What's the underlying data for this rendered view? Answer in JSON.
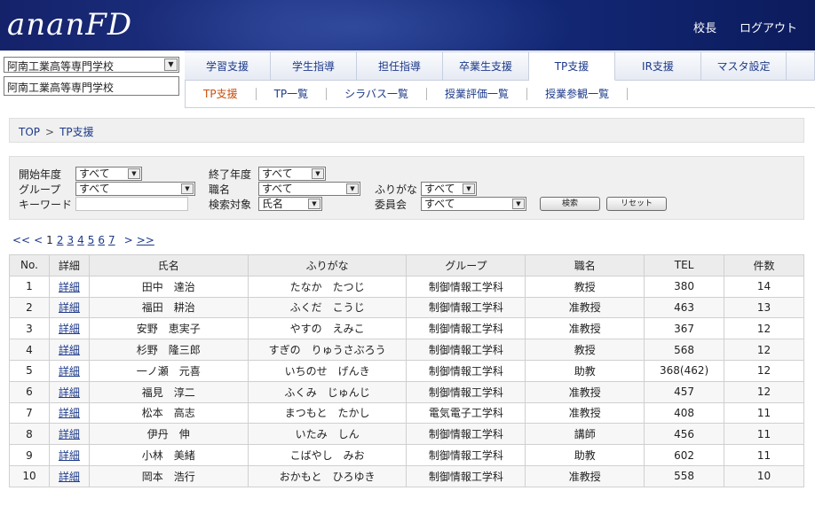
{
  "header": {
    "logo": "ananFD",
    "links": [
      "校長",
      "ログアウト"
    ]
  },
  "school": {
    "selected": "阿南工業高等専門学校",
    "display": "阿南工業高等専門学校"
  },
  "tabs": [
    {
      "label": "学習支援"
    },
    {
      "label": "学生指導"
    },
    {
      "label": "担任指導"
    },
    {
      "label": "卒業生支援"
    },
    {
      "label": "TP支援",
      "active": true
    },
    {
      "label": "IR支援"
    },
    {
      "label": "マスタ設定"
    }
  ],
  "subnav": [
    "TP支援",
    "TP一覧",
    "シラバス一覧",
    "授業評価一覧",
    "授業参観一覧"
  ],
  "breadcrumb": {
    "top": "TOP",
    "sep": ">",
    "current": "TP支援"
  },
  "search": {
    "start_year_label": "開始年度",
    "start_year_value": "すべて",
    "end_year_label": "終了年度",
    "end_year_value": "すべて",
    "group_label": "グループ",
    "group_value": "すべて",
    "position_label": "職名",
    "position_value": "すべて",
    "furigana_label": "ふりがな",
    "furigana_value": "すべて",
    "keyword_label": "キーワード",
    "keyword_value": "",
    "target_label": "検索対象",
    "target_value": "氏名",
    "committee_label": "委員会",
    "committee_value": "すべて",
    "search_button": "検索",
    "reset_button": "リセット"
  },
  "pager": {
    "first": "<<",
    "prev": "<",
    "current": "1",
    "pages": [
      "2",
      "3",
      "4",
      "5",
      "6",
      "7"
    ],
    "next": ">",
    "last": ">>"
  },
  "table": {
    "headers": [
      "No.",
      "詳細",
      "氏名",
      "ふりがな",
      "グループ",
      "職名",
      "TEL",
      "件数"
    ],
    "rows": [
      [
        "1",
        "詳細",
        "田中　達治",
        "たなか　たつじ",
        "制御情報工学科",
        "教授",
        "380",
        "14"
      ],
      [
        "2",
        "詳細",
        "福田　耕治",
        "ふくだ　こうじ",
        "制御情報工学科",
        "准教授",
        "463",
        "13"
      ],
      [
        "3",
        "詳細",
        "安野　恵実子",
        "やすの　えみこ",
        "制御情報工学科",
        "准教授",
        "367",
        "12"
      ],
      [
        "4",
        "詳細",
        "杉野　隆三郎",
        "すぎの　りゅうさぶろう",
        "制御情報工学科",
        "教授",
        "568",
        "12"
      ],
      [
        "5",
        "詳細",
        "一ノ瀬　元喜",
        "いちのせ　げんき",
        "制御情報工学科",
        "助教",
        "368(462)",
        "12"
      ],
      [
        "6",
        "詳細",
        "福見　淳二",
        "ふくみ　じゅんじ",
        "制御情報工学科",
        "准教授",
        "457",
        "12"
      ],
      [
        "7",
        "詳細",
        "松本　高志",
        "まつもと　たかし",
        "電気電子工学科",
        "准教授",
        "408",
        "11"
      ],
      [
        "8",
        "詳細",
        "伊丹　伸",
        "いたみ　しん",
        "制御情報工学科",
        "講師",
        "456",
        "11"
      ],
      [
        "9",
        "詳細",
        "小林　美緒",
        "こばやし　みお",
        "制御情報工学科",
        "助教",
        "602",
        "11"
      ],
      [
        "10",
        "詳細",
        "岡本　浩行",
        "おかもと　ひろゆき",
        "制御情報工学科",
        "准教授",
        "558",
        "10"
      ]
    ]
  }
}
